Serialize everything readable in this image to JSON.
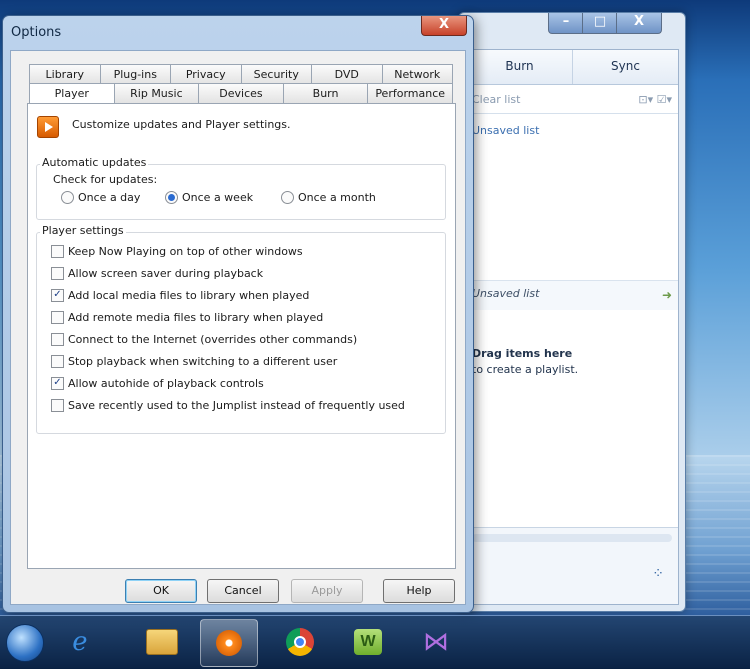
{
  "dialog": {
    "title": "Options",
    "close_glyph": "X",
    "tabs_row1": [
      "Library",
      "Plug-ins",
      "Privacy",
      "Security",
      "DVD",
      "Network"
    ],
    "tabs_row2": [
      "Player",
      "Rip Music",
      "Devices",
      "Burn",
      "Performance"
    ],
    "selected_tab": "Player",
    "header_text": "Customize updates and Player settings.",
    "auto_updates": {
      "label": "Automatic updates",
      "check_label": "Check for updates:",
      "options": [
        "Once a day",
        "Once a week",
        "Once a month"
      ],
      "selected": "Once a week"
    },
    "player_settings": {
      "label": "Player settings",
      "items": [
        {
          "label": "Keep Now Playing on top of other windows",
          "checked": false
        },
        {
          "label": "Allow screen saver during playback",
          "checked": false
        },
        {
          "label": "Add local media files to library when played",
          "checked": true
        },
        {
          "label": "Add remote media files to library when played",
          "checked": false
        },
        {
          "label": "Connect to the Internet (overrides other commands)",
          "checked": false
        },
        {
          "label": "Stop playback when switching to a different user",
          "checked": false
        },
        {
          "label": "Allow autohide of playback controls",
          "checked": true
        },
        {
          "label": "Save recently used to the Jumplist instead of frequently used",
          "checked": false
        }
      ]
    },
    "buttons": {
      "ok": "OK",
      "cancel": "Cancel",
      "apply": "Apply",
      "help": "Help"
    }
  },
  "wmp": {
    "controls": {
      "min": "–",
      "max": "□",
      "close": "X"
    },
    "tabs": [
      "Burn",
      "Sync"
    ],
    "toolbar_left": "Clear list",
    "toolbar_right": "⊡▾ ☑▾",
    "saved_link": "Unsaved list",
    "unsaved_label": "Unsaved list",
    "drag_title": "Drag items here",
    "drag_sub": "to create a playlist."
  },
  "taskbar": {
    "icons": [
      "start-orb-icon",
      "internet-explorer-icon",
      "file-explorer-icon",
      "media-player-icon",
      "chrome-icon",
      "wordweb-icon",
      "visual-studio-icon"
    ]
  }
}
